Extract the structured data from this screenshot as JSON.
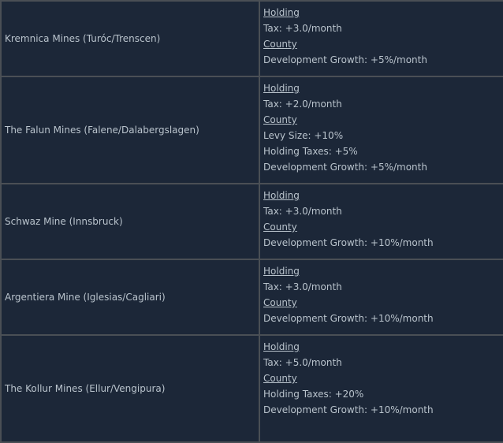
{
  "mines": [
    {
      "name": "Kremnica Mines (Turóc/Trenscen)",
      "holding_label": "Holding",
      "holding": [
        "Tax: +3.0/month"
      ],
      "county_label": "County",
      "county": [
        "Development Growth: +5%/month"
      ]
    },
    {
      "name": "The Falun Mines (Falene/Dalabergslagen)",
      "holding_label": "Holding",
      "holding": [
        "Tax: +2.0/month"
      ],
      "county_label": "County",
      "county": [
        "Levy Size: +10%",
        "Holding Taxes: +5%",
        "Development Growth: +5%/month"
      ]
    },
    {
      "name": "Schwaz Mine (Innsbruck)",
      "holding_label": "Holding",
      "holding": [
        "Tax: +3.0/month"
      ],
      "county_label": "County",
      "county": [
        "Development Growth: +10%/month"
      ]
    },
    {
      "name": "Argentiera Mine (Iglesias/Cagliari)",
      "holding_label": "Holding",
      "holding": [
        "Tax: +3.0/month"
      ],
      "county_label": "County",
      "county": [
        "Development Growth: +10%/month"
      ]
    },
    {
      "name": "The Kollur Mines (Ellur/Vengipura)",
      "holding_label": "Holding",
      "holding": [
        "Tax: +5.0/month"
      ],
      "county_label": "County",
      "county": [
        "Holding Taxes: +20%",
        "Development Growth: +10%/month"
      ]
    }
  ]
}
